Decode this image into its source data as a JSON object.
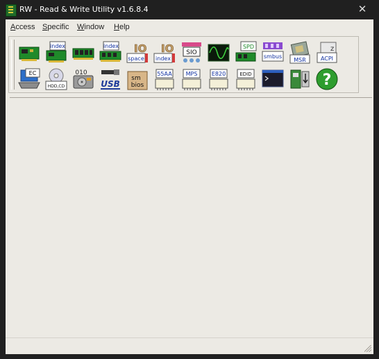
{
  "window": {
    "title": "RW - Read & Write Utility v1.6.8.4",
    "close_glyph": "✕"
  },
  "menu": {
    "items": [
      {
        "accel": "A",
        "rest": "ccess"
      },
      {
        "accel": "S",
        "rest": "pecific"
      },
      {
        "accel": "W",
        "rest": "indow"
      },
      {
        "accel": "H",
        "rest": "elp"
      }
    ]
  },
  "toolbar": {
    "labels": {
      "io_index": "index",
      "mem_index": "index",
      "io_space": "space",
      "io_index2": "index",
      "sio": "SIO",
      "spd": "SPD",
      "smbus": "smbus",
      "msr": "MSR",
      "acpi": "ACPI",
      "ec": "EC",
      "hdd_cd": "HDD,CD",
      "mem_hex": "010",
      "usb": "USB",
      "smbios_1": "sm",
      "smbios_2": "bios",
      "rom_55aa": "55AA",
      "mps": "MPS",
      "e820": "E820",
      "edid": "EDID"
    }
  },
  "colors": {
    "accent_green": "#1f8a2a",
    "question_green": "#2e9d2e"
  }
}
